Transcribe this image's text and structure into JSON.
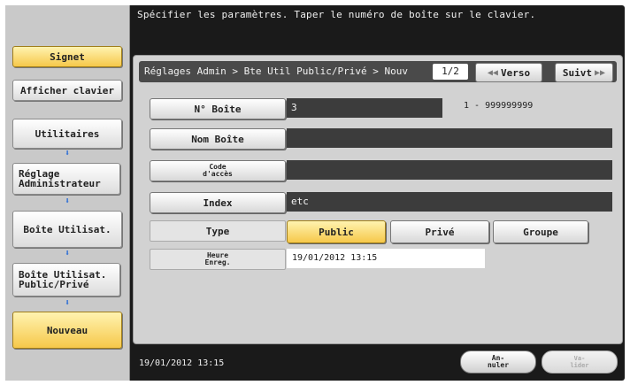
{
  "instruction": "Spécifier les paramètres. Taper le numéro de boîte sur le clavier.",
  "left_panel": {
    "signet": "Signet",
    "afficher_clavier": "Afficher clavier",
    "steps": [
      {
        "label": "Utilitaires"
      },
      {
        "label": "Réglage\nAdministrateur"
      },
      {
        "label": "Boîte Utilisat."
      },
      {
        "label": "Boîte Utilisat.\nPublic/Privé"
      },
      {
        "label": "Nouveau"
      }
    ]
  },
  "breadcrumb": "Réglages Admin > Bte Util Public/Privé > Nouv",
  "page_indicator": "1/2",
  "nav": {
    "prev_label": "Verso",
    "next_label": "Suivt"
  },
  "form": {
    "box_number": {
      "label": "N° Boîte",
      "value": "3",
      "range": "1 - 999999999"
    },
    "box_name": {
      "label": "Nom Boîte",
      "value": ""
    },
    "access_code": {
      "label_line1": "Code",
      "label_line2": "d'accès",
      "value": ""
    },
    "index": {
      "label": "Index",
      "value": "etc"
    },
    "type": {
      "label": "Type",
      "options": [
        "Public",
        "Privé",
        "Groupe"
      ],
      "selected": "Public"
    },
    "registration_time": {
      "label_line1": "Heure",
      "label_line2": "Enreg.",
      "value": "19/01/2012   13:15"
    }
  },
  "footer": {
    "datetime": "19/01/2012    13:15",
    "cancel_line1": "An-",
    "cancel_line2": "nuler",
    "ok_line1": "Va-",
    "ok_line2": "lider"
  },
  "colors": {
    "accent_yellow": "#f6c84a",
    "background_dark": "#1a1a1a",
    "panel_gray": "#d2d2d2",
    "arrow_blue": "#2d6fd6"
  }
}
